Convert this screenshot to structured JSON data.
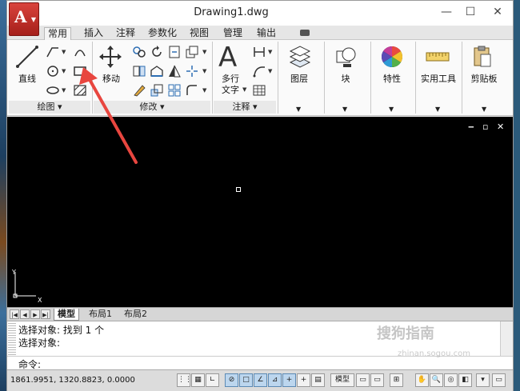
{
  "window": {
    "title": "Drawing1.dwg",
    "app_button_letter": "A",
    "controls": {
      "minimize": "—",
      "maximize": "☐",
      "close": "✕"
    }
  },
  "ribbon_tabs": [
    "常用",
    "插入",
    "注释",
    "参数化",
    "视图",
    "管理",
    "输出"
  ],
  "panels": {
    "draw": {
      "title": "绘图",
      "line_label": "直线"
    },
    "modify": {
      "title": "修改",
      "move_label": "移动"
    },
    "annotation": {
      "title": "注释",
      "mtext_label_1": "多行",
      "mtext_label_2": "文字"
    },
    "layers": {
      "label": "图层"
    },
    "block": {
      "label": "块"
    },
    "properties": {
      "label": "特性"
    },
    "utilities": {
      "label": "实用工具"
    },
    "clipboard": {
      "label": "剪贴板"
    }
  },
  "drawing_area": {
    "background": "#000000",
    "ucs_x": "X",
    "ucs_y": "Y",
    "viewport_controls": [
      "‒",
      "▫",
      "✕"
    ]
  },
  "layout_tabs": [
    "模型",
    "布局1",
    "布局2"
  ],
  "command_history": [
    "选择对象: 找到 1 个",
    "选择对象:"
  ],
  "command_prompt": "命令:",
  "status": {
    "coordinates": "1861.9951, 1320.8823, 0.0000",
    "model_label": "模型"
  },
  "watermark": {
    "text": "搜狗指南",
    "url": "zhinan.sogou.com"
  },
  "colors": {
    "accent_red": "#e8463f",
    "app_red": "#c0302a"
  }
}
